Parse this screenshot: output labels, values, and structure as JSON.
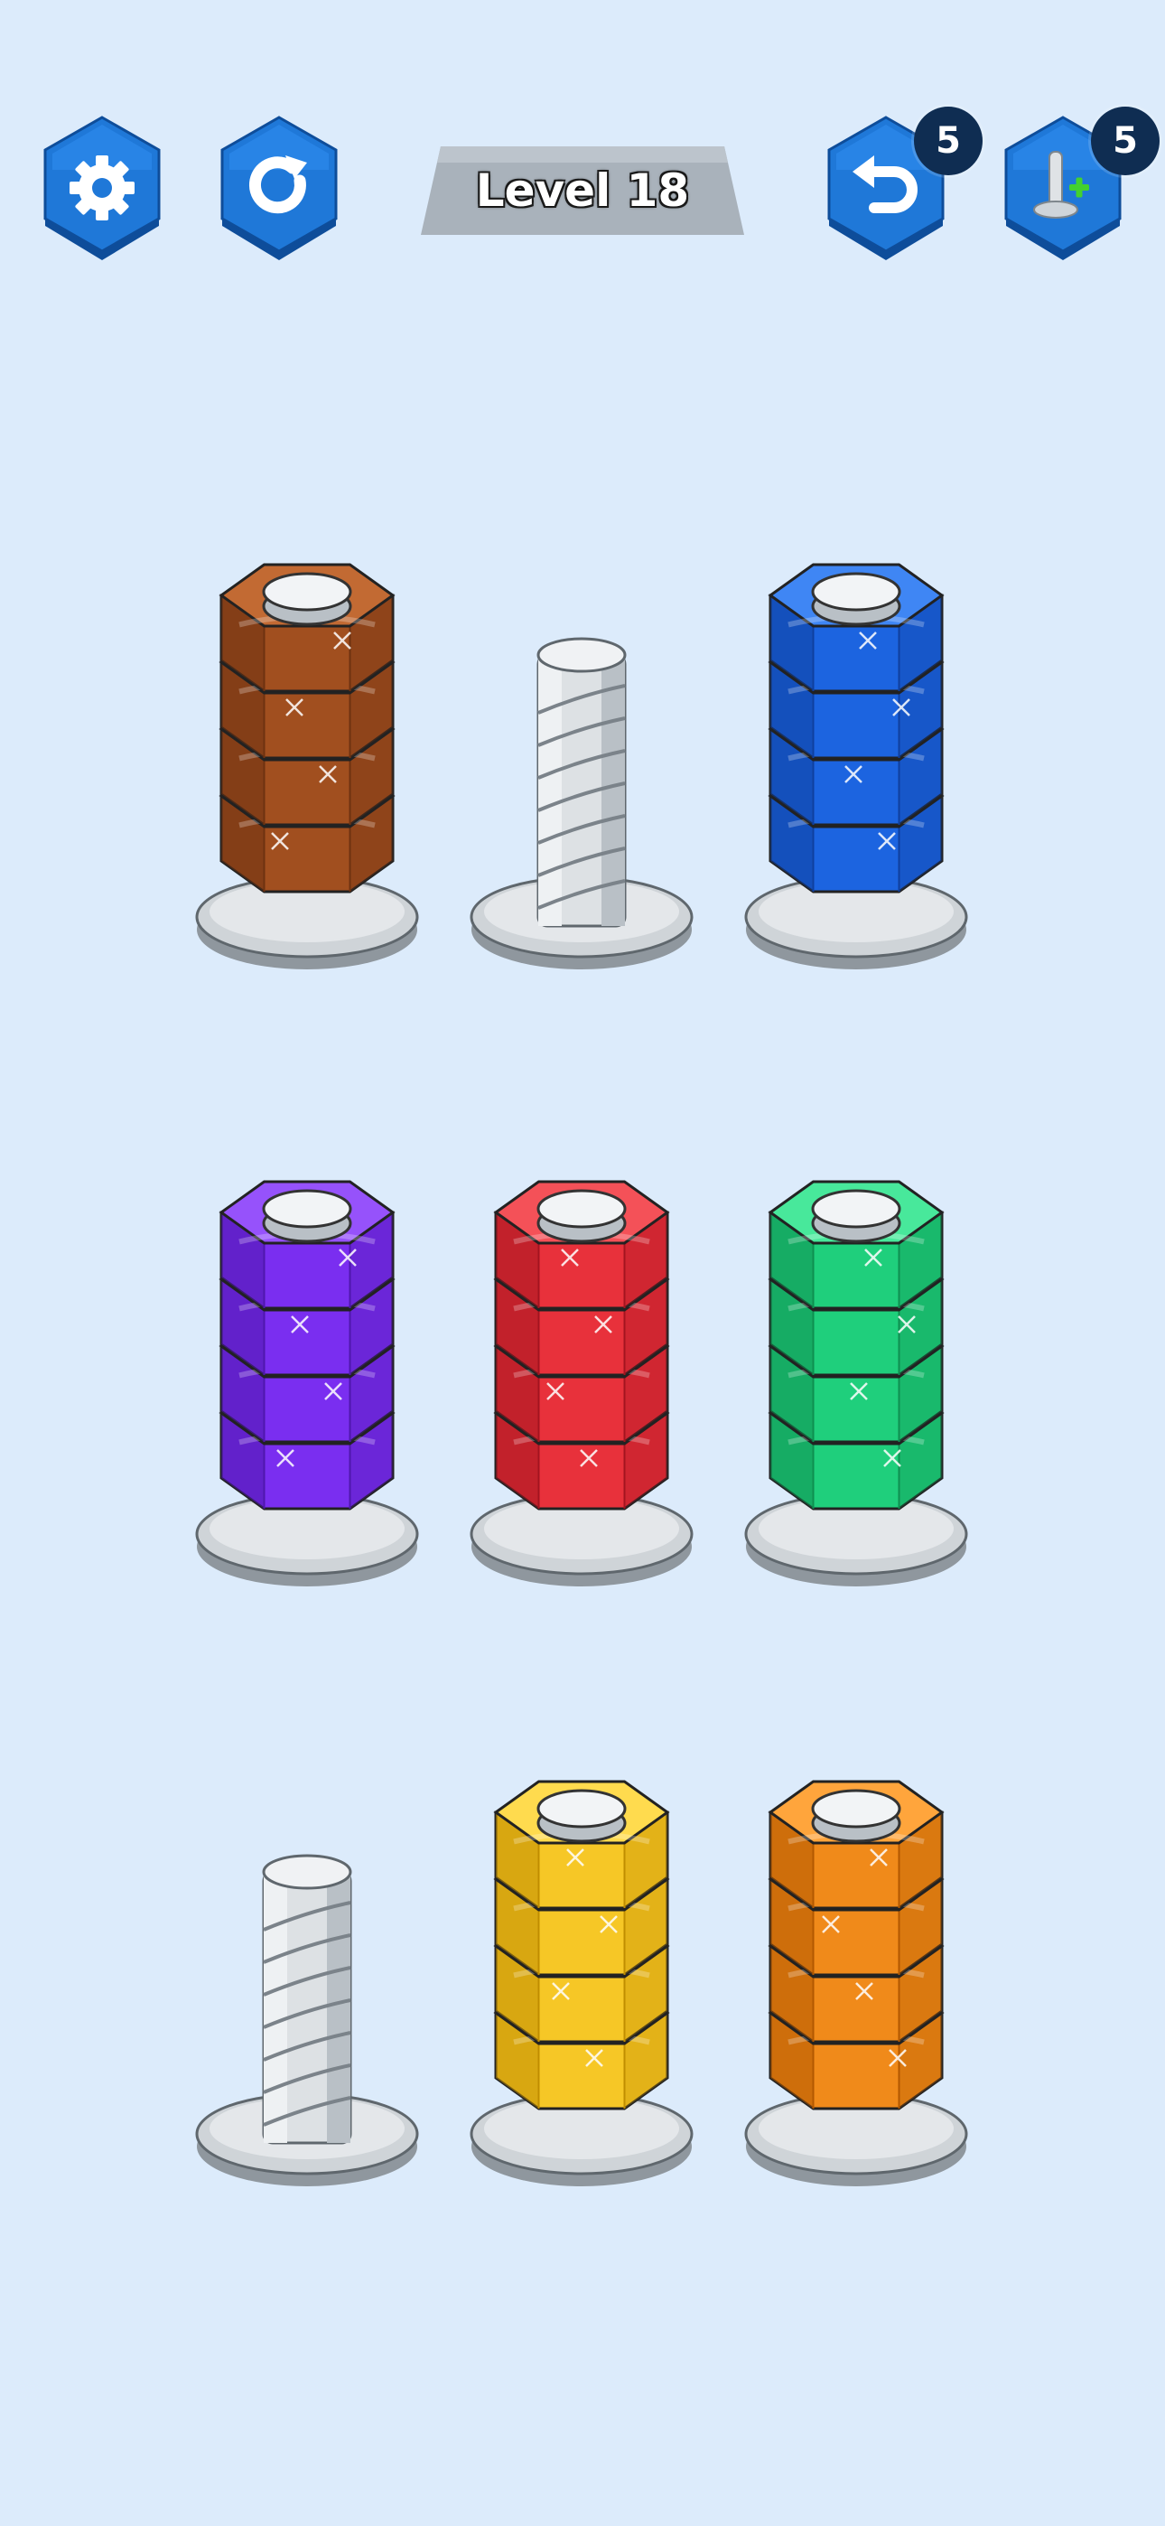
{
  "hud": {
    "settings_icon": "gear-icon",
    "restart_icon": "restart-icon",
    "level_label": "Level 18",
    "undo_icon": "undo-icon",
    "undo_count": "5",
    "add_screw_icon": "add-screw-icon",
    "add_screw_count": "5"
  },
  "colors": {
    "background": "#dcebfb",
    "button_blue": "#1f78d8",
    "badge_navy": "#0f2d52",
    "plate_gray": "#a9b2bb"
  },
  "board": {
    "nuts_per_full_screw": 4,
    "screws": [
      {
        "row": 1,
        "col": 1,
        "nuts": [
          "brown",
          "brown",
          "brown",
          "brown"
        ]
      },
      {
        "row": 1,
        "col": 2,
        "nuts": []
      },
      {
        "row": 1,
        "col": 3,
        "nuts": [
          "blue",
          "blue",
          "blue",
          "blue"
        ]
      },
      {
        "row": 2,
        "col": 1,
        "nuts": [
          "purple",
          "purple",
          "purple",
          "purple"
        ]
      },
      {
        "row": 2,
        "col": 2,
        "nuts": [
          "red",
          "red",
          "red",
          "red"
        ]
      },
      {
        "row": 2,
        "col": 3,
        "nuts": [
          "green",
          "green",
          "green",
          "green"
        ]
      },
      {
        "row": 3,
        "col": 1,
        "nuts": []
      },
      {
        "row": 3,
        "col": 2,
        "nuts": [
          "yellow",
          "yellow",
          "yellow",
          "yellow"
        ]
      },
      {
        "row": 3,
        "col": 3,
        "nuts": [
          "orange",
          "orange",
          "orange",
          "orange"
        ]
      }
    ],
    "nut_colors": {
      "brown": {
        "base": "#a14f1f",
        "light": "#c26a33",
        "dark": "#6e3210"
      },
      "blue": {
        "base": "#1c64e0",
        "light": "#3f86f4",
        "dark": "#0f3f9e"
      },
      "purple": {
        "base": "#7a2ef0",
        "light": "#9652fb",
        "dark": "#4f17ad"
      },
      "red": {
        "base": "#e8313b",
        "light": "#f45158",
        "dark": "#a3141f"
      },
      "green": {
        "base": "#1fcf7c",
        "light": "#48e89b",
        "dark": "#0e8f50"
      },
      "yellow": {
        "base": "#f6c726",
        "light": "#ffdb4e",
        "dark": "#c08d00"
      },
      "orange": {
        "base": "#f08a1a",
        "light": "#ffa53c",
        "dark": "#b25800"
      }
    }
  }
}
